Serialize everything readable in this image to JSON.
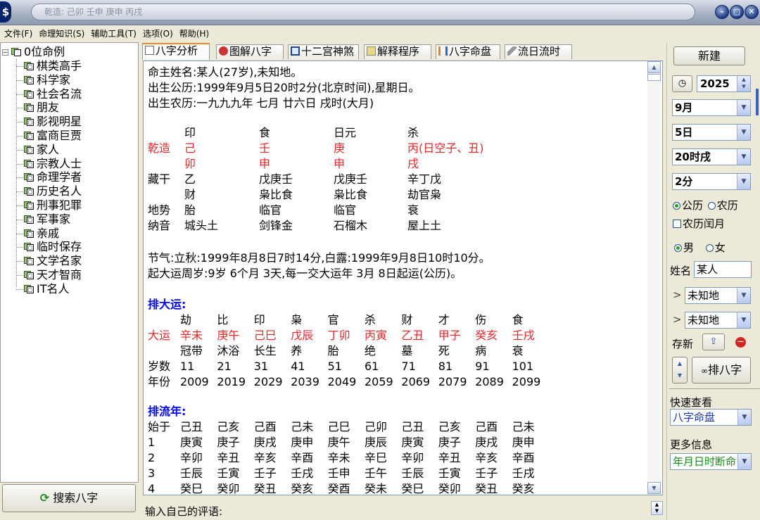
{
  "title": {
    "text": "乾造: 己卯 壬申 庚申 丙戌"
  },
  "menu": [
    "文件(F)",
    "命理知识(S)",
    "辅助工具(T)",
    "选项(O)",
    "帮助(H)"
  ],
  "tree": {
    "root": "0位命例",
    "items": [
      "棋类高手",
      "科学家",
      "社会名流",
      "朋友",
      "影视明星",
      "富商巨贾",
      "家人",
      "宗教人士",
      "命理学者",
      "历史名人",
      "刑事犯罪",
      "军事家",
      "亲戚",
      "临时保存",
      "文学名家",
      "天才智商",
      "IT名人"
    ]
  },
  "search_button": "搜索八字",
  "tabs": [
    "八字分析",
    "图解八字",
    "十二宫神煞",
    "解释程序",
    "八字命盘",
    "流日流时"
  ],
  "content": {
    "line1": "命主姓名:某人(27岁),未知地。",
    "line2": "出生公历:1999年9月5日20时2分(北京时间),星期日。",
    "line3": "出生农历:一九九九年 七月 廿六日 戌时(大月)",
    "pillars": {
      "shishen": [
        "印",
        "食",
        "日元",
        "杀"
      ],
      "gan_label": "乾造",
      "gan": [
        "己",
        "壬",
        "庚",
        "丙(日空子、丑)"
      ],
      "zhi": [
        "卯",
        "申",
        "申",
        "戌"
      ],
      "canggan_label": "藏干",
      "canggan": [
        "乙",
        "戊庚壬",
        "戊庚壬",
        "辛丁戊"
      ],
      "canggan_shen": [
        "财",
        "枭比食",
        "枭比食",
        "劫官枭"
      ],
      "dishi_label": "地势",
      "dishi": [
        "胎",
        "临官",
        "临官",
        "衰"
      ],
      "nayin_label": "纳音",
      "nayin": [
        "城头土",
        "剑锋金",
        "石榴木",
        "屋上土"
      ]
    },
    "jieqi": "节气:立秋:1999年8月8日7时14分,白露:1999年9月8日10时10分。",
    "qiyun": "起大运周岁:9岁 6个月 3天,每一交大运年 3月 8日起运(公历)。",
    "dayun": {
      "header": "排大运:",
      "shen": [
        "劫",
        "比",
        "印",
        "枭",
        "官",
        "杀",
        "财",
        "才",
        "伤",
        "食"
      ],
      "label": "大运",
      "ganzhi": [
        "辛未",
        "庚午",
        "己巳",
        "戊辰",
        "丁卯",
        "丙寅",
        "乙丑",
        "甲子",
        "癸亥",
        "壬戌"
      ],
      "changsheng": [
        "冠带",
        "沐浴",
        "长生",
        "养",
        "胎",
        "绝",
        "墓",
        "死",
        "病",
        "衰"
      ],
      "age_label": "岁数",
      "ages": [
        "11",
        "21",
        "31",
        "41",
        "51",
        "61",
        "71",
        "81",
        "91",
        "101"
      ],
      "year_label": "年份",
      "years": [
        "2009",
        "2019",
        "2029",
        "2039",
        "2049",
        "2059",
        "2069",
        "2079",
        "2089",
        "2099"
      ]
    },
    "liunian": {
      "header": "排流年:",
      "rows": [
        {
          "label": "始于",
          "vals": [
            "己丑",
            "己亥",
            "己酉",
            "己未",
            "己巳",
            "己卯",
            "己丑",
            "己亥",
            "己酉",
            "己未"
          ]
        },
        {
          "label": "1",
          "vals": [
            "庚寅",
            "庚子",
            "庚戌",
            "庚申",
            "庚午",
            "庚辰",
            "庚寅",
            "庚子",
            "庚戌",
            "庚申"
          ]
        },
        {
          "label": "2",
          "vals": [
            "辛卯",
            "辛丑",
            "辛亥",
            "辛酉",
            "辛未",
            "辛巳",
            "辛卯",
            "辛丑",
            "辛亥",
            "辛酉"
          ]
        },
        {
          "label": "3",
          "vals": [
            "壬辰",
            "壬寅",
            "壬子",
            "壬戌",
            "壬申",
            "壬午",
            "壬辰",
            "壬寅",
            "壬子",
            "壬戌"
          ]
        },
        {
          "label": "4",
          "vals": [
            "癸巳",
            "癸卯",
            "癸丑",
            "癸亥",
            "癸酉",
            "癸未",
            "癸巳",
            "癸卯",
            "癸丑",
            "癸亥"
          ]
        }
      ]
    }
  },
  "comment_label": "输入自己的评语:",
  "right": {
    "new_button": "新建",
    "year": "2025",
    "month": "9月",
    "day": "5日",
    "hour": "20时戌",
    "minute": "2分",
    "solar": "公历",
    "lunar": "农历",
    "leap": "农历闰月",
    "male": "男",
    "female": "女",
    "name_label": "姓名",
    "name_value": "某人",
    "place1": "未知地",
    "place2": "未知地",
    "save_label": "存新",
    "paibazi": "排八字",
    "quick_label": "快速查看",
    "quick_value": "八字命盘",
    "more_label": "更多信息",
    "more_value": "年月日时断命"
  }
}
